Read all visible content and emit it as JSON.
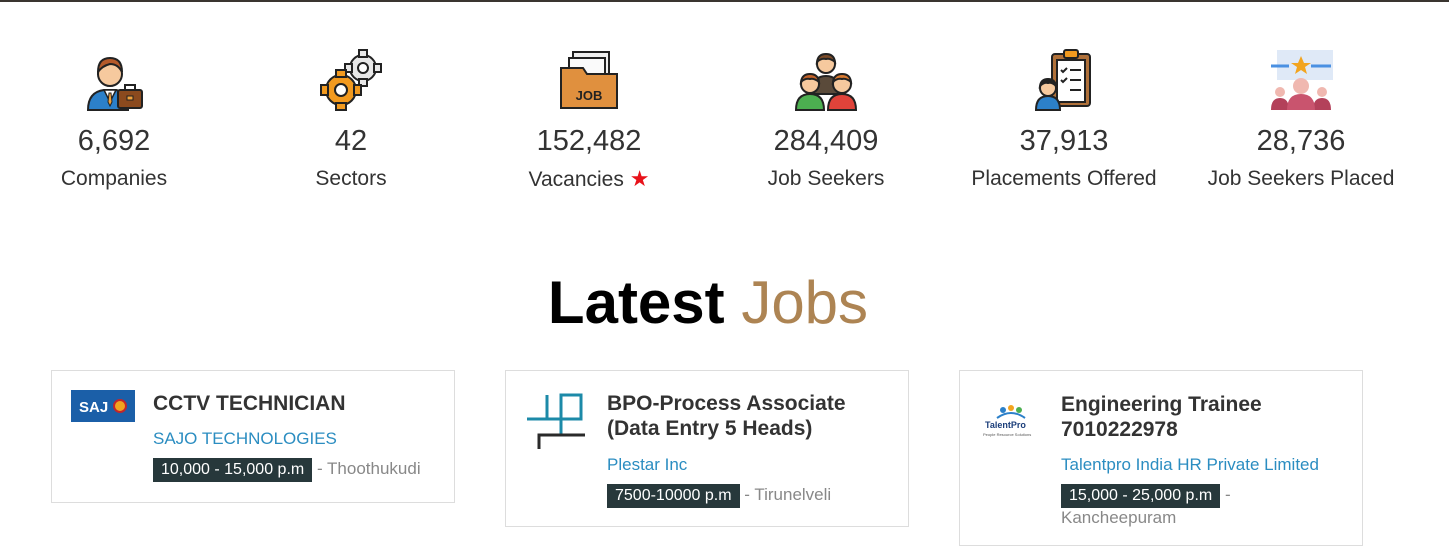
{
  "stats": [
    {
      "icon": "businessman-briefcase-icon",
      "value": "6,692",
      "label": "Companies"
    },
    {
      "icon": "gears-icon",
      "value": "42",
      "label": "Sectors"
    },
    {
      "icon": "job-folder-icon",
      "value": "152,482",
      "label": "Vacancies"
    },
    {
      "icon": "people-group-icon",
      "value": "284,409",
      "label": "Job Seekers"
    },
    {
      "icon": "clipboard-person-icon",
      "value": "37,913",
      "label": "Placements Offered"
    },
    {
      "icon": "star-people-icon",
      "value": "28,736",
      "label": "Job Seekers Placed"
    }
  ],
  "section": {
    "title_main": "Latest",
    "title_accent": "Jobs"
  },
  "jobs": [
    {
      "title": "CCTV TECHNICIAN",
      "company": "SAJO TECHNOLOGIES",
      "salary": "10,000 - 15,000 p.m",
      "location": "Thoothukudi",
      "logo_text": "SAJ"
    },
    {
      "title": "BPO-Process Associate (Data Entry 5 Heads)",
      "company": "Plestar Inc",
      "salary": "7500-10000 p.m",
      "location": "Tirunelveli"
    },
    {
      "title": "Engineering Trainee 7010222978",
      "company": "Talentpro India HR Private Limited",
      "salary": "15,000 - 25,000 p.m",
      "location": "Kancheepuram",
      "logo_text": "TalentPro",
      "logo_subtext": "People Resource Solutions"
    }
  ],
  "colors": {
    "accent": "#ad8453",
    "link": "#2b8dc1",
    "salary_bg": "#27383b",
    "star": "#e8121a"
  }
}
